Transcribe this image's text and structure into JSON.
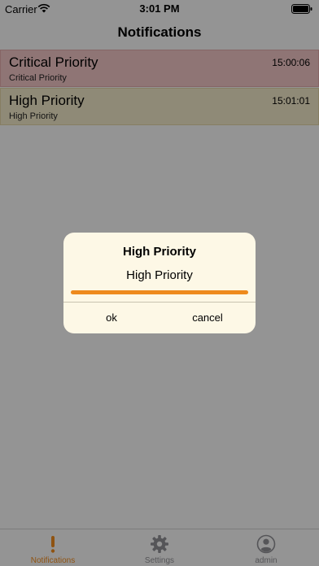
{
  "status_bar": {
    "carrier": "Carrier",
    "time": "3:01 PM"
  },
  "nav": {
    "title": "Notifications"
  },
  "notifications": [
    {
      "title": "Critical Priority",
      "subtitle": "Critical Priority",
      "time": "15:00:06",
      "color": "#efc3c3"
    },
    {
      "title": "High Priority",
      "subtitle": "High Priority",
      "time": "15:01:01",
      "color": "#efe6c6"
    }
  ],
  "dialog": {
    "title": "High Priority",
    "message": "High Priority",
    "progress": 1.0,
    "ok_label": "ok",
    "cancel_label": "cancel"
  },
  "tabs": [
    {
      "label": "Notifications",
      "icon": "exclamation-icon",
      "active": true
    },
    {
      "label": "Settings",
      "icon": "gear-icon",
      "active": false
    },
    {
      "label": "admin",
      "icon": "user-icon",
      "active": false
    }
  ],
  "colors": {
    "accent": "#ee8a1d",
    "critical_row": "#efc3c3",
    "high_row": "#efe6c6",
    "dialog_bg": "#fdf8e6"
  }
}
